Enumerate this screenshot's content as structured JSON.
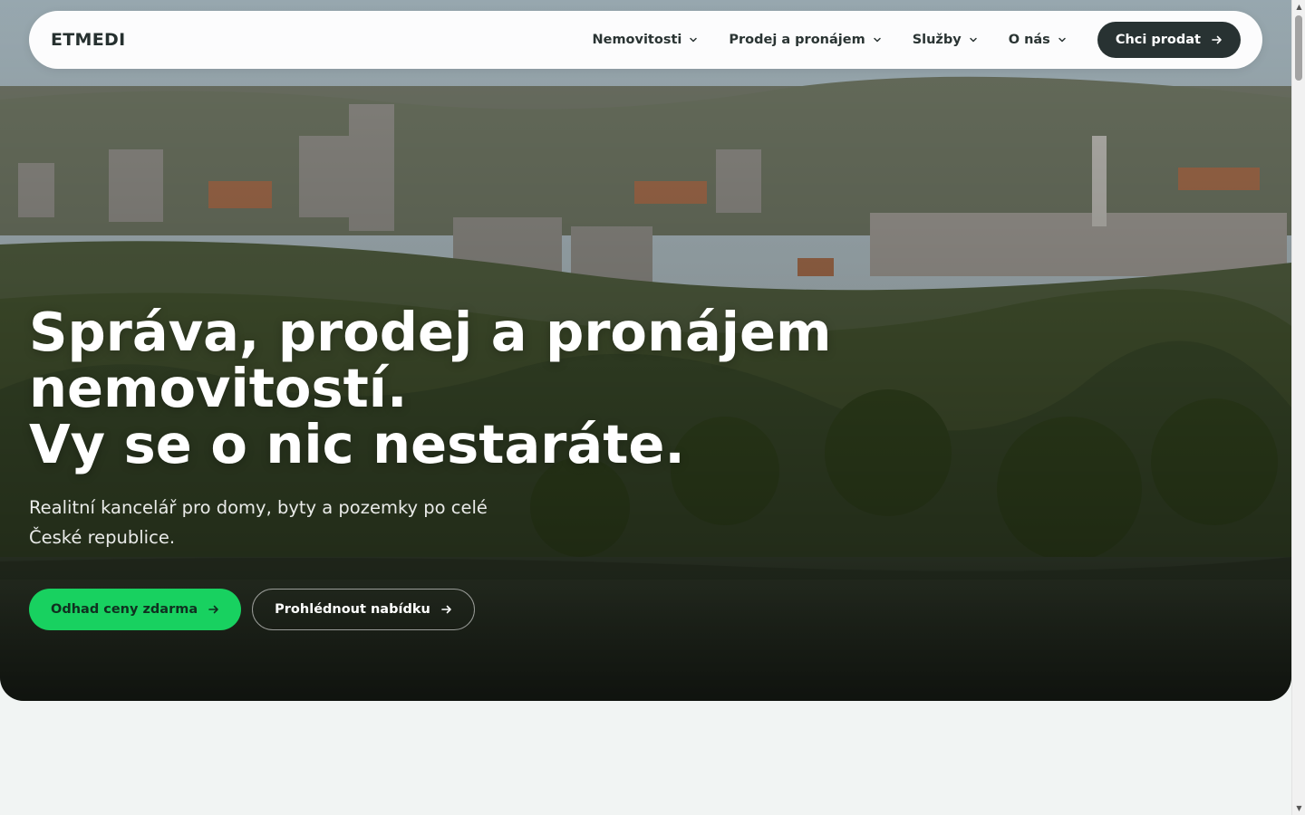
{
  "brand": {
    "name": "ETMEDI"
  },
  "nav": {
    "items": [
      {
        "label": "Nemovitosti",
        "icon": "chevron-down-icon"
      },
      {
        "label": "Prodej a pronájem",
        "icon": "chevron-down-icon"
      },
      {
        "label": "Služby",
        "icon": "chevron-down-icon"
      },
      {
        "label": "O nás",
        "icon": "chevron-down-icon"
      }
    ],
    "cta": {
      "label": "Chci prodat",
      "icon": "arrow-right-icon"
    }
  },
  "hero": {
    "title_lines": [
      "Správa, prodej a pronájem",
      "nemovitostí.",
      "Vy se o nic nestaráte."
    ],
    "subtitle": "Realitní kancelář pro domy, byty a pozemky po celé České republice.",
    "primary_button": {
      "label": "Odhad ceny zdarma",
      "icon": "arrow-right-icon"
    },
    "secondary_button": {
      "label": "Prohlédnout nabídku",
      "icon": "arrow-right-icon"
    },
    "background": "city-river-panorama"
  },
  "colors": {
    "accent_green": "#18d160",
    "dark_button": "#283232",
    "page_background": "#f1f4f3"
  },
  "scrollbar": {
    "up_icon": "scroll-up-arrow-icon",
    "down_icon": "scroll-down-arrow-icon"
  }
}
